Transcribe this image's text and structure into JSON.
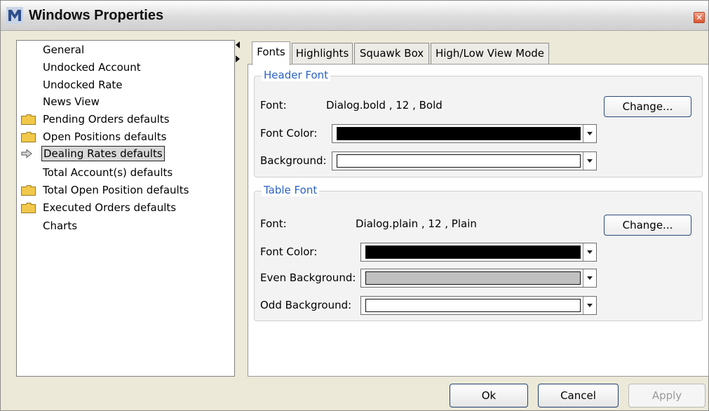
{
  "window": {
    "title": "Windows Properties",
    "close_glyph": "✕"
  },
  "tree": {
    "items": [
      {
        "label": "General",
        "icon": "none"
      },
      {
        "label": "Undocked Account",
        "icon": "none"
      },
      {
        "label": "Undocked Rate",
        "icon": "none"
      },
      {
        "label": "News View",
        "icon": "none"
      },
      {
        "label": "Pending Orders defaults",
        "icon": "folder-icon"
      },
      {
        "label": "Open Positions defaults",
        "icon": "folder-icon"
      },
      {
        "label": "Dealing Rates defaults",
        "icon": "arrow-icon",
        "selected": true
      },
      {
        "label": "Total Account(s) defaults",
        "icon": "none"
      },
      {
        "label": "Total Open Position defaults",
        "icon": "folder-icon"
      },
      {
        "label": "Executed Orders defaults",
        "icon": "folder-icon"
      },
      {
        "label": "Charts",
        "icon": "none"
      }
    ]
  },
  "tabs": [
    {
      "label": "Fonts",
      "active": true
    },
    {
      "label": "Highlights"
    },
    {
      "label": "Squawk Box"
    },
    {
      "label": "High/Low View Mode"
    }
  ],
  "header_font": {
    "group_title": "Header Font",
    "font_label": "Font:",
    "font_value": "Dialog.bold , 12 , Bold",
    "change_button": "Change...",
    "font_color_label": "Font Color:",
    "font_color": "#000000",
    "background_label": "Background:",
    "background": "#ffffff"
  },
  "table_font": {
    "group_title": "Table Font",
    "font_label": "Font:",
    "font_value": "Dialog.plain , 12 , Plain",
    "change_button": "Change...",
    "font_color_label": "Font Color:",
    "font_color": "#000000",
    "even_background_label": "Even Background:",
    "even_background": "#c0c0c0",
    "odd_background_label": "Odd Background:",
    "odd_background": "#ffffff"
  },
  "footer": {
    "ok": "Ok",
    "cancel": "Cancel",
    "apply": "Apply"
  }
}
